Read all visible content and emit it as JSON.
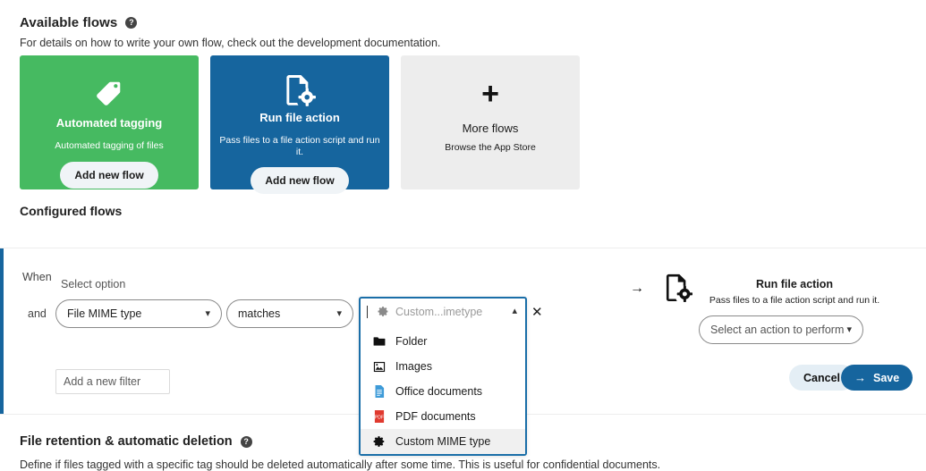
{
  "available": {
    "title": "Available flows",
    "help_icon": "help-circle-icon",
    "subtitle": "For details on how to write your own flow, check out the development documentation.",
    "cards": [
      {
        "id": "automated-tagging",
        "title": "Automated tagging",
        "desc": "Automated tagging of files",
        "button": "Add new flow",
        "icon": "tag-icon",
        "bg": "#46ba61"
      },
      {
        "id": "run-file-action",
        "title": "Run file action",
        "desc": "Pass files to a file action script and run it.",
        "button": "Add new flow",
        "icon": "file-gear-icon",
        "bg": "#16659e"
      },
      {
        "id": "more-flows",
        "title": "More flows",
        "desc": "Browse the App Store",
        "icon": "plus-icon",
        "bg": "#ededed"
      }
    ]
  },
  "configured": {
    "title": "Configured flows",
    "accent_color": "#16659e",
    "when_label": "When",
    "and_label": "and",
    "select_option_label": "Select option",
    "mime_select": {
      "value": "File MIME type",
      "caret": "chevron-down-icon"
    },
    "operator_select": {
      "value": "matches",
      "caret": "chevron-down-icon"
    },
    "add_filter": {
      "placeholder": "Add a new filter"
    },
    "mime_combo": {
      "placeholder": "Custom...imetype",
      "leading_icon": "gear-icon",
      "caret": "chevron-up-icon",
      "close_icon": "close-icon",
      "options": [
        {
          "label": "Folder",
          "icon": "folder-icon",
          "selected": false
        },
        {
          "label": "Images",
          "icon": "image-icon",
          "selected": false
        },
        {
          "label": "Office documents",
          "icon": "office-document-icon",
          "selected": false
        },
        {
          "label": "PDF documents",
          "icon": "pdf-icon",
          "selected": false
        },
        {
          "label": "Custom MIME type",
          "icon": "gear-icon",
          "selected": true
        }
      ]
    },
    "action": {
      "arrow_icon": "arrow-right-icon",
      "icon": "file-gear-icon",
      "title": "Run file action",
      "desc": "Pass files to a file action script and run it.",
      "select_placeholder": "Select an action to perform",
      "caret": "chevron-down-icon",
      "cancel_label": "Cancel",
      "save_label": "Save",
      "save_icon": "arrow-right-icon"
    }
  },
  "retention": {
    "title": "File retention & automatic deletion",
    "help_icon": "help-circle-icon",
    "subtitle": "Define if files tagged with a specific tag should be deleted automatically after some time. This is useful for confidential documents."
  }
}
